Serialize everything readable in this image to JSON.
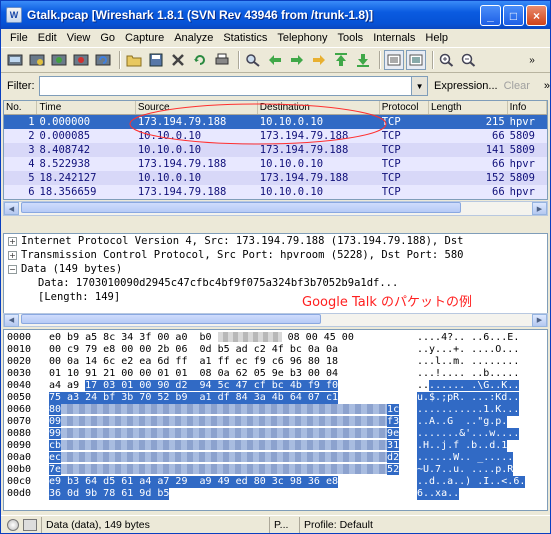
{
  "window": {
    "title": "Gtalk.pcap   [Wireshark 1.8.1  (SVN Rev 43946 from /trunk-1.8)]"
  },
  "titlebar_buttons": {
    "minimize": "_",
    "maximize": "□",
    "close": "×"
  },
  "menu": [
    "File",
    "Edit",
    "View",
    "Go",
    "Capture",
    "Analyze",
    "Statistics",
    "Telephony",
    "Tools",
    "Internals",
    "Help"
  ],
  "toolbar_icons": [
    "interface-list-icon",
    "capture-options-icon",
    "start-capture-icon",
    "stop-capture-icon",
    "restart-capture-icon",
    "open-file-icon",
    "save-file-icon",
    "close-file-icon",
    "reload-icon",
    "print-icon",
    "find-icon",
    "back-icon",
    "forward-icon",
    "goto-icon",
    "first-packet-icon",
    "last-packet-icon",
    "colorize-icon",
    "autoscroll-icon",
    "zoom-in-icon",
    "zoom-out-icon"
  ],
  "filter": {
    "label": "Filter:",
    "value": "",
    "expression": "Expression...",
    "clear": "Clear"
  },
  "packet_list": {
    "columns": [
      "No.",
      "Time",
      "Source",
      "Destination",
      "Protocol",
      "Length",
      "Info"
    ],
    "rows": [
      {
        "no": "1",
        "time": "0.000000",
        "src": "173.194.79.188",
        "dst": "10.10.0.10",
        "proto": "TCP",
        "len": "215",
        "info": "hpvr"
      },
      {
        "no": "2",
        "time": "0.000085",
        "src": "10.10.0.10",
        "dst": "173.194.79.188",
        "proto": "TCP",
        "len": "66",
        "info": "5809"
      },
      {
        "no": "3",
        "time": "8.408742",
        "src": "10.10.0.10",
        "dst": "173.194.79.188",
        "proto": "TCP",
        "len": "141",
        "info": "5809"
      },
      {
        "no": "4",
        "time": "8.522938",
        "src": "173.194.79.188",
        "dst": "10.10.0.10",
        "proto": "TCP",
        "len": "66",
        "info": "hpvr"
      },
      {
        "no": "5",
        "time": "18.242127",
        "src": "10.10.0.10",
        "dst": "173.194.79.188",
        "proto": "TCP",
        "len": "152",
        "info": "5809"
      },
      {
        "no": "6",
        "time": "18.356659",
        "src": "173.194.79.188",
        "dst": "10.10.0.10",
        "proto": "TCP",
        "len": "66",
        "info": "hpvr"
      }
    ]
  },
  "details": {
    "ip": "Internet Protocol Version 4, Src: 173.194.79.188 (173.194.79.188), Dst",
    "tcp": "Transmission Control Protocol, Src Port: hpvroom (5228), Dst Port: 580",
    "data": "Data (149 bytes)",
    "data_value": "Data: 1703010090d2945c47cfbc4bf9f075a324bf3b7052b9a1df...",
    "length": "[Length: 149]",
    "annotation": "Google Talk のパケットの例"
  },
  "hex": {
    "offsets": [
      "0000",
      "0010",
      "0020",
      "0030",
      "0040",
      "0050",
      "0060",
      "0070",
      "0080",
      "0090",
      "00a0",
      "00b0",
      "00c0",
      "00d0"
    ],
    "row0_bytes": "e0 b9 a5 8c 34 3f 00 a0  b0",
    "row0_bytes_tail": "08 00 45 00",
    "row0_ascii": "....4?.. ..6...E.",
    "row1_bytes": "00 c9 79 e8 00 00 2b 06  0d b5 ad c2 4f bc 0a 0a",
    "row1_ascii": "..y...+. ....O...",
    "row2_bytes": "00 0a 14 6c e2 ea 6d ff  a1 ff ec f9 c6 96 80 18",
    "row2_ascii": "...l..m. ........",
    "row3_bytes": "01 10 91 21 00 00 01 01  08 0a 62 05 9e b3 00 04",
    "row3_ascii": "...!.... ..b.....",
    "row4_bytes_plain": "a4 a9 ",
    "row4_bytes_hl": "17 03 01 00 90 d2  94 5c 47 cf bc 4b f9 f0",
    "row4_ascii_plain": "..",
    "row4_ascii_hl": "...... .\\G..K..",
    "row5_bytes": "75 a3 24 bf 3b 70 52 b9  a1 df 84 3a 4b 64 07 c1",
    "row5_ascii": "u.$.;pR. ...:Kd..",
    "row6_lead": "80",
    "row6_tail": "1c",
    "row6_ascii": "...........1.K...",
    "row7_lead": "09",
    "row7_tail": "f3",
    "row7_ascii": "..A..G  ..\"g.p.",
    "row8_lead": "99",
    "row8_tail": "9e",
    "row8_ascii": ".......&'...w....",
    "row9_lead": "cb",
    "row9_tail": "31",
    "row9_ascii": ".H..j.f .b..d.1",
    "row10_lead": "ec",
    "row10_tail": "d2",
    "row10_ascii": "......W.. _.....",
    "row11_lead": "7e",
    "row11_tail": "52",
    "row11_ascii": "~U.7..u. ....p.R",
    "row12_bytes": "e9 b3 64 d5 61 a4 a7 29  a9 49 ed 80 3c 98 36 e8",
    "row12_ascii": "..d..a..) .I..<.6.",
    "row13_bytes": "36 0d 9b 78 61 9d b5",
    "row13_ascii": "6..xa.."
  },
  "status": {
    "field": "Data (data), 149 bytes",
    "packets": "P...",
    "profile": "Profile: Default"
  }
}
